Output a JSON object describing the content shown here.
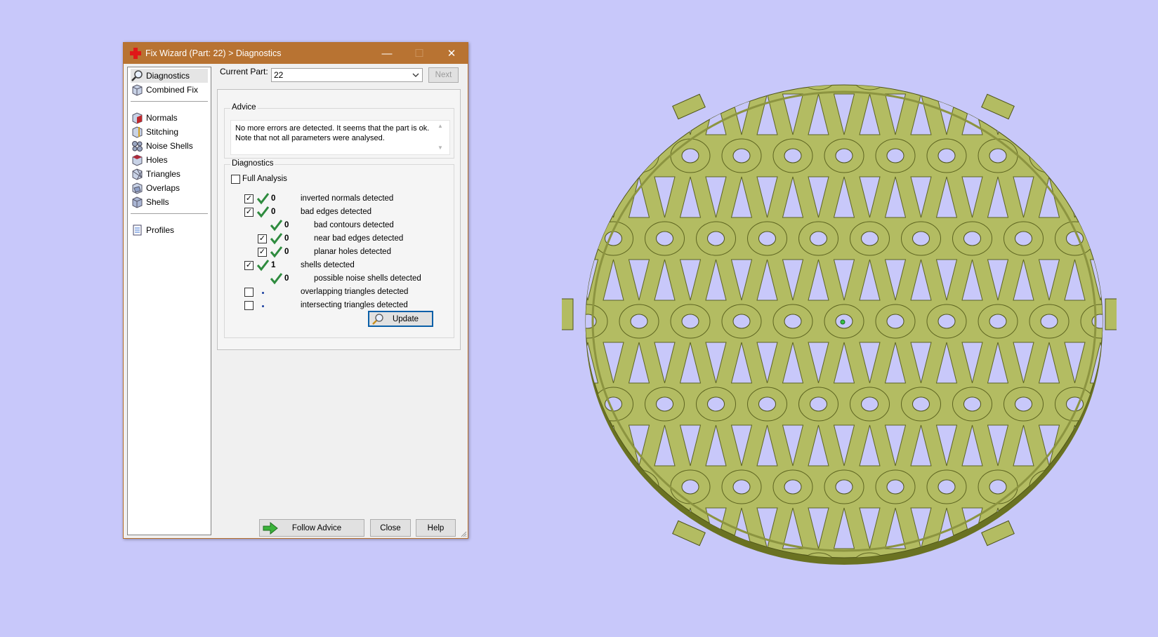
{
  "dialog": {
    "title": "Fix Wizard (Part: 22) > Diagnostics",
    "window_controls": {
      "minimize": "—",
      "maximize": "☐",
      "close": "✕"
    }
  },
  "sidebar": {
    "top_items": [
      {
        "label": "Diagnostics",
        "icon": "magnifier-icon"
      },
      {
        "label": "Combined Fix",
        "icon": "cube-icon"
      }
    ],
    "fix_items": [
      {
        "label": "Normals",
        "icon": "normals-icon"
      },
      {
        "label": "Stitching",
        "icon": "stitching-icon"
      },
      {
        "label": "Noise Shells",
        "icon": "noise-shells-icon"
      },
      {
        "label": "Holes",
        "icon": "holes-icon"
      },
      {
        "label": "Triangles",
        "icon": "triangles-icon"
      },
      {
        "label": "Overlaps",
        "icon": "overlaps-icon"
      },
      {
        "label": "Shells",
        "icon": "shells-icon"
      }
    ],
    "bottom_items": [
      {
        "label": "Profiles",
        "icon": "profiles-icon"
      }
    ]
  },
  "current_part": {
    "label": "Current Part:",
    "value": "22",
    "next_label": "Next"
  },
  "advice": {
    "title": "Advice",
    "text": "No more errors are detected. It seems that the part is ok.\nNote that not all parameters were analysed."
  },
  "diagnostics": {
    "title": "Diagnostics",
    "full_analysis_label": "Full Analysis",
    "rows": [
      {
        "count": "0",
        "label": "inverted normals detected"
      },
      {
        "count": "0",
        "label": "bad edges detected"
      },
      {
        "count": "0",
        "label": "bad contours detected"
      },
      {
        "count": "0",
        "label": "near bad edges detected"
      },
      {
        "count": "0",
        "label": "planar holes detected"
      },
      {
        "count": "1",
        "label": "shells detected"
      },
      {
        "count": "0",
        "label": "possible noise shells detected"
      },
      {
        "count": "",
        "label": "overlapping triangles detected"
      },
      {
        "count": "",
        "label": "intersecting triangles detected"
      }
    ],
    "update_label": "Update"
  },
  "footer": {
    "follow_advice": "Follow Advice",
    "close": "Close",
    "help": "Help"
  },
  "colors": {
    "background": "#c8c8fa",
    "title_bar": "#b87332",
    "model_face": "#b3bc62",
    "model_side": "#6a7222",
    "check_green": "#2e8b3e"
  }
}
